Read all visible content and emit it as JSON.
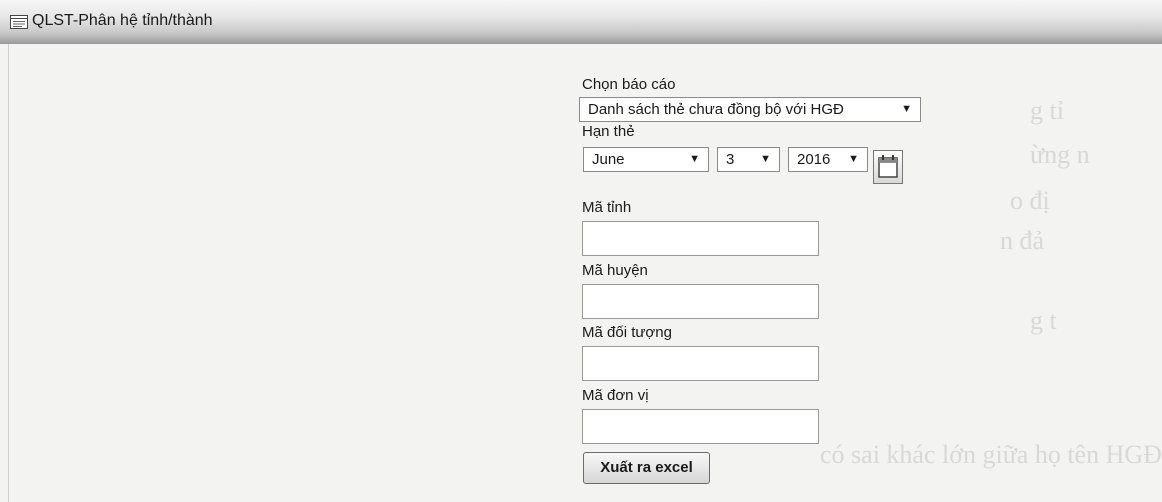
{
  "window": {
    "title": "QLST-Phân hệ tỉnh/thành"
  },
  "form": {
    "report_label": "Chọn báo cáo",
    "report_value": "Danh sách thẻ chưa đồng bộ với HGĐ",
    "expiry_label": "Hạn thẻ",
    "month_value": "June",
    "day_value": "3",
    "year_value": "2016",
    "province_label": "Mã tỉnh",
    "province_value": "",
    "district_label": "Mã huyện",
    "district_value": "",
    "object_label": "Mã đối tượng",
    "object_value": "",
    "unit_label": "Mã đơn vị",
    "unit_value": "",
    "export_button": "Xuất ra excel"
  },
  "icons": {
    "title_icon": "window-list-icon",
    "calendar": "calendar-icon",
    "dropdown": "chevron-down-icon"
  },
  "colors": {
    "titlebar_top": "#f7f7f7",
    "titlebar_bottom": "#9a9a9a",
    "background": "#f3f3f1"
  }
}
